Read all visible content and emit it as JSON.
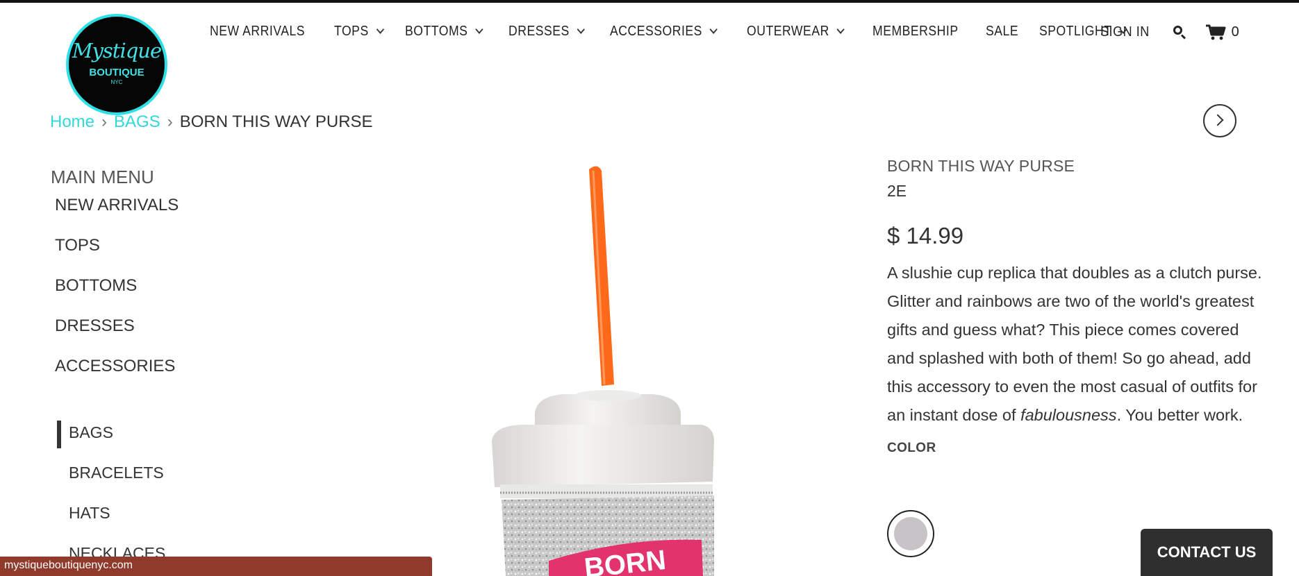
{
  "logo": {
    "script": "Mystique",
    "sub": "BOUTIQUE",
    "city": "NYC"
  },
  "nav": [
    {
      "label": "NEW ARRIVALS",
      "dropdown": false
    },
    {
      "label": "TOPS",
      "dropdown": true
    },
    {
      "label": "BOTTOMS",
      "dropdown": true
    },
    {
      "label": "DRESSES",
      "dropdown": true
    },
    {
      "label": "ACCESSORIES",
      "dropdown": true
    },
    {
      "label": "OUTERWEAR",
      "dropdown": true
    },
    {
      "label": "MEMBERSHIP",
      "dropdown": false
    },
    {
      "label": "SALE",
      "dropdown": false
    },
    {
      "label": "SPOTLIGHT",
      "dropdown": true
    }
  ],
  "header_right": {
    "signin": "SIGN IN",
    "search_icon": "search-icon",
    "cart_icon": "cart-icon",
    "cart_count": "0"
  },
  "breadcrumb": {
    "home": "Home",
    "category": "BAGS",
    "current": "BORN THIS WAY PURSE"
  },
  "sidebar": {
    "title": "MAIN MENU",
    "items": [
      "NEW ARRIVALS",
      "TOPS",
      "BOTTOMS",
      "DRESSES",
      "ACCESSORIES"
    ],
    "subitems": [
      "BAGS",
      "BRACELETS",
      "HATS",
      "NECKLACES"
    ],
    "active_subitem": "BAGS"
  },
  "product": {
    "title": "BORN THIS WAY PURSE",
    "sku": "2E",
    "price": "$ 14.99",
    "desc_main": "A slushie cup replica that doubles as a clutch purse. Glitter and rainbows are two of the world's greatest gifts and guess what? This piece comes covered and splashed with both of them! So go ahead, add this accessory to even the most casual of outfits for an instant dose of ",
    "desc_em": "fabulousness",
    "desc_end": ". You better work.",
    "color_label": "COLOR",
    "swatch_color": "#c7c3c7",
    "image_text": "BORN"
  },
  "contact": {
    "label": "CONTACT US"
  },
  "status_url": "mystiqueboutiquenyc.com",
  "colors": {
    "accent": "#32d6dd",
    "straw": "#ff6a1a",
    "status_bar": "#8f3a2a"
  }
}
